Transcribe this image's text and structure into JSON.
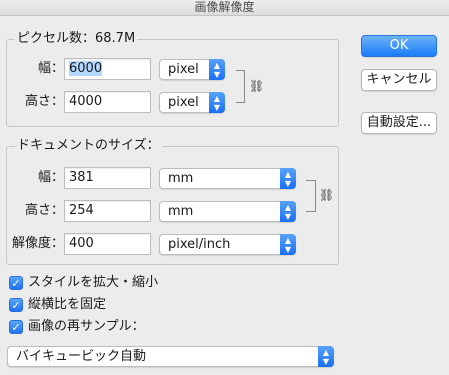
{
  "window": {
    "title": "画像解像度"
  },
  "pixel_dimensions": {
    "legend": "ピクセル数：68.7M",
    "width_label": "幅：",
    "width_value": "6000",
    "width_unit": "pixel",
    "height_label": "高さ：",
    "height_value": "4000",
    "height_unit": "pixel"
  },
  "document_size": {
    "legend": "ドキュメントのサイズ：",
    "width_label": "幅：",
    "width_value": "381",
    "width_unit": "mm",
    "height_label": "高さ：",
    "height_value": "254",
    "height_unit": "mm",
    "resolution_label": "解像度：",
    "resolution_value": "400",
    "resolution_unit": "pixel/inch"
  },
  "options": {
    "scale_styles": {
      "label": "スタイルを拡大・縮小",
      "checked": true
    },
    "constrain_proportions": {
      "label": "縦横比を固定",
      "checked": true
    },
    "resample": {
      "label": "画像の再サンプル：",
      "checked": true
    }
  },
  "resample_method": "バイキュービック自動",
  "buttons": {
    "ok": "OK",
    "cancel": "キャンセル",
    "auto": "自動設定..."
  },
  "icons": {
    "link": "chain-link-icon",
    "checkmark": "checkmark-icon",
    "stepper": "up-down-chevron-icon"
  },
  "colors": {
    "accent": "#1b7cf6",
    "background": "#ececec",
    "text_highlight": "#b3d7ff"
  }
}
